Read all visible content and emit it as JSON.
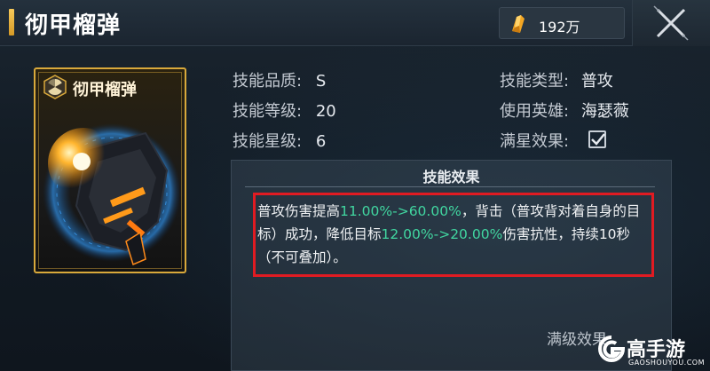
{
  "header": {
    "title": "彻甲榴弹",
    "currency_value": "192万",
    "accent_color": "#f2c04e"
  },
  "card": {
    "title": "彻甲榴弹",
    "emblem_icon": "hex-emblem-icon",
    "art_icon": "grenade-launcher-art",
    "frame_color": "#d9a93b"
  },
  "info": {
    "quality_label": "技能品质:",
    "quality_value": "S",
    "level_label": "技能等级:",
    "level_value": "20",
    "star_label": "技能星级:",
    "star_value": "6",
    "type_label": "技能类型:",
    "type_value": "普攻",
    "hero_label": "使用英雄:",
    "hero_value": "海瑟薇",
    "fullstar_label": "满星效果:"
  },
  "effect": {
    "title": "技能效果",
    "text_1": "普攻伤害提高",
    "hl_1": "11.00%->60.00%",
    "text_2": "，背击（普攻背对着自身的目标）成功，降低目标",
    "hl_2": "12.00%->20.00%",
    "text_3": "伤害抗性，持续10秒（不可叠加）。",
    "highlight_color": "#41d6a0",
    "box_color": "#e11b22",
    "maxlevel_label": "满级效果:"
  },
  "watermark": {
    "text": "高手游",
    "sub": "GAOSHOUYOU.COM"
  }
}
